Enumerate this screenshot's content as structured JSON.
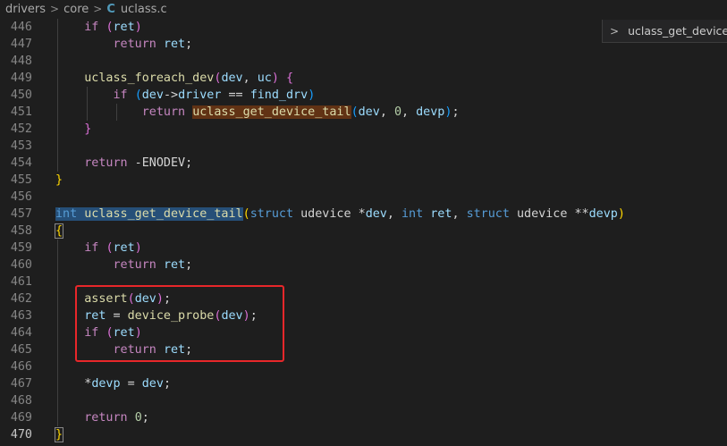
{
  "breadcrumb": {
    "items": [
      "drivers",
      "core"
    ],
    "file_icon": "C",
    "file_name": "uclass.c",
    "separator": ">"
  },
  "sticky_widget": {
    "chevron": ">",
    "label": "uclass_get_device_"
  },
  "colors": {
    "background": "#1e1e1e",
    "keyword": "#c586c0",
    "type_keyword": "#569cd6",
    "function": "#dcdcaa",
    "variable": "#9cdcfe",
    "number": "#b5cea8",
    "annotation_box": "#e8272a"
  },
  "active_line": "470",
  "lines": [
    {
      "n": "446",
      "tokens": [
        {
          "t": "    "
        },
        {
          "t": "if",
          "c": "kw"
        },
        {
          "t": " "
        },
        {
          "t": "(",
          "c": "brace2"
        },
        {
          "t": "ret",
          "c": "var"
        },
        {
          "t": ")",
          "c": "brace2"
        }
      ]
    },
    {
      "n": "447",
      "tokens": [
        {
          "t": "        "
        },
        {
          "t": "return",
          "c": "kw"
        },
        {
          "t": " "
        },
        {
          "t": "ret",
          "c": "var"
        },
        {
          "t": ";"
        }
      ]
    },
    {
      "n": "448",
      "tokens": []
    },
    {
      "n": "449",
      "tokens": [
        {
          "t": "    "
        },
        {
          "t": "uclass_foreach_dev",
          "c": "fn"
        },
        {
          "t": "(",
          "c": "brace2"
        },
        {
          "t": "dev",
          "c": "var"
        },
        {
          "t": ", "
        },
        {
          "t": "uc",
          "c": "var"
        },
        {
          "t": ")",
          "c": "brace2"
        },
        {
          "t": " "
        },
        {
          "t": "{",
          "c": "brace2"
        }
      ]
    },
    {
      "n": "450",
      "tokens": [
        {
          "t": "        "
        },
        {
          "t": "if",
          "c": "kw"
        },
        {
          "t": " "
        },
        {
          "t": "(",
          "c": "brace3"
        },
        {
          "t": "dev",
          "c": "var"
        },
        {
          "t": "->"
        },
        {
          "t": "driver",
          "c": "var"
        },
        {
          "t": " == "
        },
        {
          "t": "find_drv",
          "c": "var"
        },
        {
          "t": ")",
          "c": "brace3"
        }
      ]
    },
    {
      "n": "451",
      "tokens": [
        {
          "t": "            "
        },
        {
          "t": "return",
          "c": "kw"
        },
        {
          "t": " "
        },
        {
          "t": "uclass_get_device_tail",
          "c": "fn",
          "h": "hl-find"
        },
        {
          "t": "(",
          "c": "brace3"
        },
        {
          "t": "dev",
          "c": "var"
        },
        {
          "t": ", "
        },
        {
          "t": "0",
          "c": "num"
        },
        {
          "t": ", "
        },
        {
          "t": "devp",
          "c": "var"
        },
        {
          "t": ")",
          "c": "brace3"
        },
        {
          "t": ";"
        }
      ]
    },
    {
      "n": "452",
      "tokens": [
        {
          "t": "    "
        },
        {
          "t": "}",
          "c": "brace2"
        }
      ]
    },
    {
      "n": "453",
      "tokens": []
    },
    {
      "n": "454",
      "tokens": [
        {
          "t": "    "
        },
        {
          "t": "return",
          "c": "kw"
        },
        {
          "t": " -"
        },
        {
          "t": "ENODEV",
          "c": "plain"
        },
        {
          "t": ";"
        }
      ]
    },
    {
      "n": "455",
      "tokens": [
        {
          "t": "}",
          "c": "brace1"
        }
      ]
    },
    {
      "n": "456",
      "tokens": []
    },
    {
      "n": "457",
      "tokens": [
        {
          "t": "int",
          "c": "kwb",
          "h": "hl-sel"
        },
        {
          "t": " ",
          "h": "hl-sel"
        },
        {
          "t": "uclass_get_device_tail",
          "c": "fn",
          "h": "hl-sel"
        },
        {
          "t": "(",
          "c": "brace1"
        },
        {
          "t": "struct",
          "c": "kwb"
        },
        {
          "t": " "
        },
        {
          "t": "udevice",
          "c": "plain"
        },
        {
          "t": " *"
        },
        {
          "t": "dev",
          "c": "var"
        },
        {
          "t": ", "
        },
        {
          "t": "int",
          "c": "kwb"
        },
        {
          "t": " "
        },
        {
          "t": "ret",
          "c": "var"
        },
        {
          "t": ", "
        },
        {
          "t": "struct",
          "c": "kwb"
        },
        {
          "t": " "
        },
        {
          "t": "udevice",
          "c": "plain"
        },
        {
          "t": " **"
        },
        {
          "t": "devp",
          "c": "var"
        },
        {
          "t": ")",
          "c": "brace1"
        }
      ]
    },
    {
      "n": "458",
      "tokens": [
        {
          "t": "{",
          "c": "brace1",
          "h": "cursor-box"
        }
      ]
    },
    {
      "n": "459",
      "tokens": [
        {
          "t": "    "
        },
        {
          "t": "if",
          "c": "kw"
        },
        {
          "t": " "
        },
        {
          "t": "(",
          "c": "brace2"
        },
        {
          "t": "ret",
          "c": "var"
        },
        {
          "t": ")",
          "c": "brace2"
        }
      ]
    },
    {
      "n": "460",
      "tokens": [
        {
          "t": "        "
        },
        {
          "t": "return",
          "c": "kw"
        },
        {
          "t": " "
        },
        {
          "t": "ret",
          "c": "var"
        },
        {
          "t": ";"
        }
      ]
    },
    {
      "n": "461",
      "tokens": []
    },
    {
      "n": "462",
      "tokens": [
        {
          "t": "    "
        },
        {
          "t": "assert",
          "c": "fn"
        },
        {
          "t": "(",
          "c": "brace2"
        },
        {
          "t": "dev",
          "c": "var"
        },
        {
          "t": ")",
          "c": "brace2"
        },
        {
          "t": ";"
        }
      ]
    },
    {
      "n": "463",
      "tokens": [
        {
          "t": "    "
        },
        {
          "t": "ret",
          "c": "var"
        },
        {
          "t": " = "
        },
        {
          "t": "device_probe",
          "c": "fn"
        },
        {
          "t": "(",
          "c": "brace2"
        },
        {
          "t": "dev",
          "c": "var"
        },
        {
          "t": ")",
          "c": "brace2"
        },
        {
          "t": ";"
        }
      ]
    },
    {
      "n": "464",
      "tokens": [
        {
          "t": "    "
        },
        {
          "t": "if",
          "c": "kw"
        },
        {
          "t": " "
        },
        {
          "t": "(",
          "c": "brace2"
        },
        {
          "t": "ret",
          "c": "var"
        },
        {
          "t": ")",
          "c": "brace2"
        }
      ]
    },
    {
      "n": "465",
      "tokens": [
        {
          "t": "        "
        },
        {
          "t": "return",
          "c": "kw"
        },
        {
          "t": " "
        },
        {
          "t": "ret",
          "c": "var"
        },
        {
          "t": ";"
        }
      ]
    },
    {
      "n": "466",
      "tokens": []
    },
    {
      "n": "467",
      "tokens": [
        {
          "t": "    *"
        },
        {
          "t": "devp",
          "c": "var"
        },
        {
          "t": " = "
        },
        {
          "t": "dev",
          "c": "var"
        },
        {
          "t": ";"
        }
      ]
    },
    {
      "n": "468",
      "tokens": []
    },
    {
      "n": "469",
      "tokens": [
        {
          "t": "    "
        },
        {
          "t": "return",
          "c": "kw"
        },
        {
          "t": " "
        },
        {
          "t": "0",
          "c": "num"
        },
        {
          "t": ";"
        }
      ]
    },
    {
      "n": "470",
      "tokens": [
        {
          "t": "}",
          "c": "brace1",
          "h": "cursor-box"
        }
      ]
    }
  ]
}
